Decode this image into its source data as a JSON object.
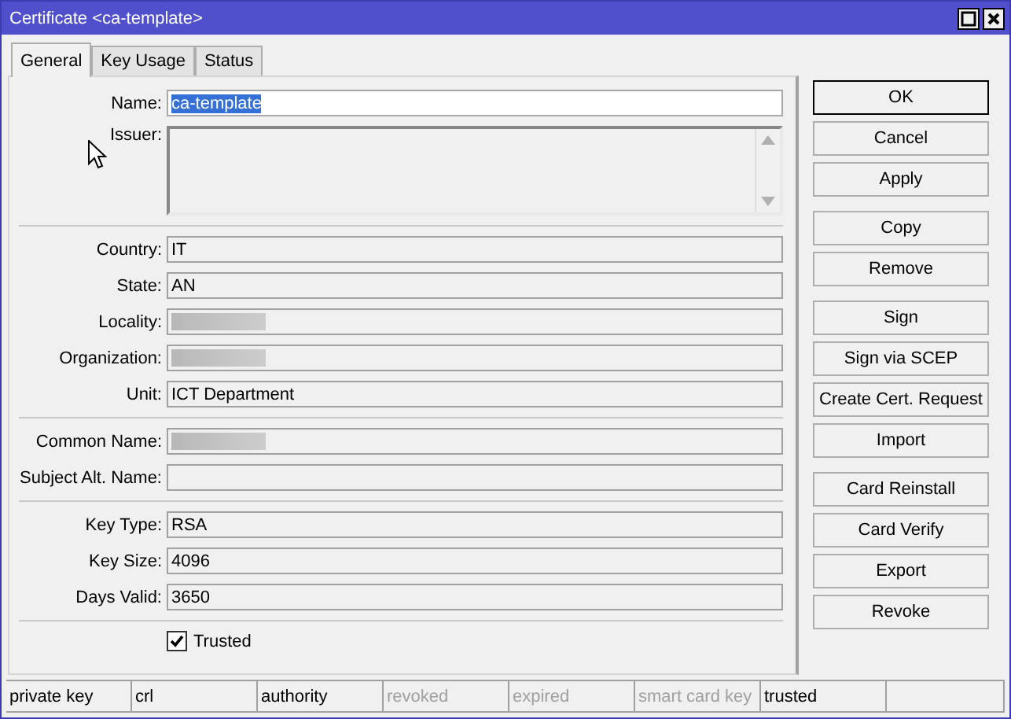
{
  "window": {
    "title": "Certificate <ca-template>"
  },
  "tabs": [
    {
      "label": "General",
      "selected": true
    },
    {
      "label": "Key Usage",
      "selected": false
    },
    {
      "label": "Status",
      "selected": false
    }
  ],
  "form": {
    "sections": [
      [
        {
          "label": "Name:",
          "kind": "input",
          "value": "ca-template",
          "selected": true
        },
        {
          "label": "Issuer:",
          "kind": "textarea"
        }
      ],
      [
        {
          "label": "Country:",
          "kind": "readonly",
          "value": "IT"
        },
        {
          "label": "State:",
          "kind": "readonly",
          "value": "AN"
        },
        {
          "label": "Locality:",
          "kind": "readonly",
          "redacted": true
        },
        {
          "label": "Organization:",
          "kind": "readonly",
          "redacted": true
        },
        {
          "label": "Unit:",
          "kind": "readonly",
          "value": "ICT Department"
        }
      ],
      [
        {
          "label": "Common Name:",
          "kind": "readonly",
          "redacted": true
        },
        {
          "label": "Subject Alt. Name:",
          "kind": "readonly"
        }
      ],
      [
        {
          "label": "Key Type:",
          "kind": "readonly",
          "value": "RSA"
        },
        {
          "label": "Key Size:",
          "kind": "readonly",
          "value": "4096"
        },
        {
          "label": "Days Valid:",
          "kind": "readonly",
          "value": "3650"
        }
      ]
    ],
    "trusted": {
      "label": "Trusted",
      "checked": true
    }
  },
  "buttons": [
    [
      "OK",
      "Cancel",
      "Apply"
    ],
    [
      "Copy",
      "Remove"
    ],
    [
      "Sign",
      "Sign via SCEP",
      "Create Cert. Request",
      "Import"
    ],
    [
      "Card Reinstall",
      "Card Verify",
      "Export",
      "Revoke"
    ]
  ],
  "status_bar": [
    {
      "text": "private key",
      "active": true
    },
    {
      "text": "crl",
      "active": true
    },
    {
      "text": "authority",
      "active": true
    },
    {
      "text": "revoked",
      "active": false
    },
    {
      "text": "expired",
      "active": false
    },
    {
      "text": "smart card key",
      "active": false
    },
    {
      "text": "trusted",
      "active": true
    }
  ]
}
